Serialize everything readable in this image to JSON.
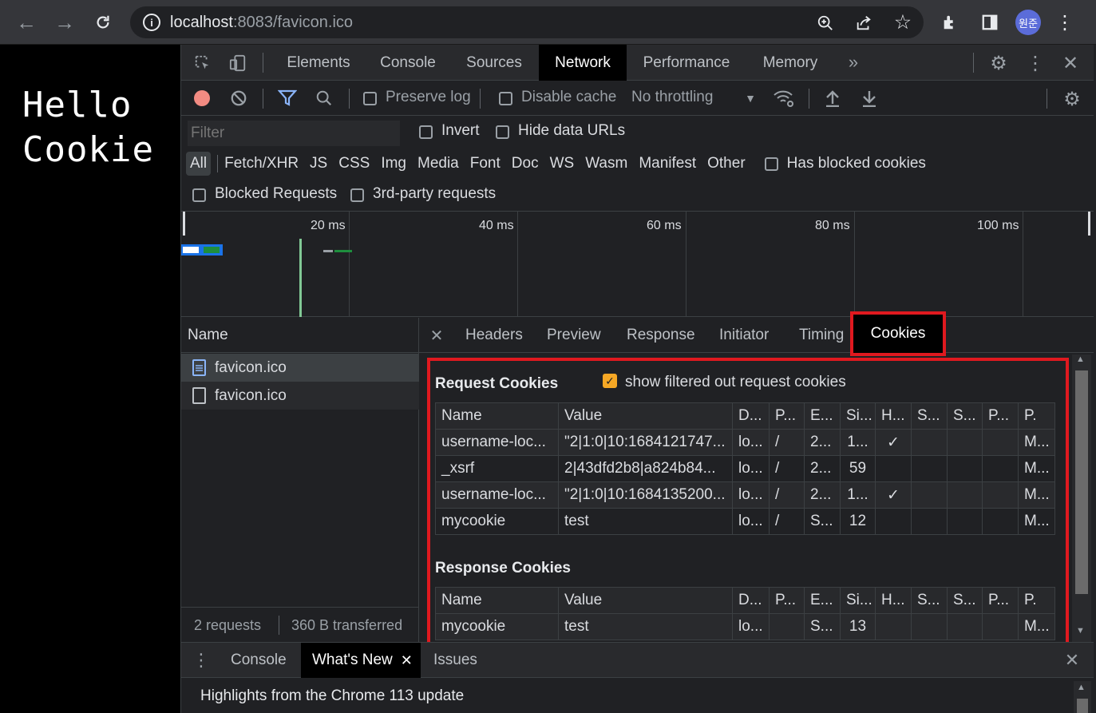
{
  "browser": {
    "url_host": "localhost",
    "url_rest": ":8083/favicon.ico",
    "avatar": "원준"
  },
  "page": {
    "line1": "Hello",
    "line2": "Cookie"
  },
  "devtools": {
    "main_tabs": [
      "Elements",
      "Console",
      "Sources",
      "Network",
      "Performance",
      "Memory"
    ],
    "active_tab": "Network",
    "toolbar": {
      "preserve_log": "Preserve log",
      "disable_cache": "Disable cache",
      "throttling": "No throttling"
    },
    "filter": {
      "placeholder": "Filter",
      "invert": "Invert",
      "hide_data_urls": "Hide data URLs"
    },
    "type_filters": [
      "All",
      "Fetch/XHR",
      "JS",
      "CSS",
      "Img",
      "Media",
      "Font",
      "Doc",
      "WS",
      "Wasm",
      "Manifest",
      "Other"
    ],
    "has_blocked_cookies": "Has blocked cookies",
    "blocked_requests": "Blocked Requests",
    "third_party": "3rd-party requests",
    "timeline_ticks": [
      "20 ms",
      "40 ms",
      "60 ms",
      "80 ms",
      "100 ms"
    ],
    "requests": {
      "header": "Name",
      "items": [
        "favicon.ico",
        "favicon.ico"
      ],
      "footer_count": "2 requests",
      "footer_transferred": "360 B transferred"
    },
    "detail_tabs": [
      "Headers",
      "Preview",
      "Response",
      "Initiator",
      "Timing",
      "Cookies"
    ],
    "active_detail_tab": "Cookies",
    "cookies": {
      "request_title": "Request Cookies",
      "show_filtered": "show filtered out request cookies",
      "columns": [
        "Name",
        "Value",
        "D...",
        "P...",
        "E...",
        "Si...",
        "H...",
        "S...",
        "S...",
        "P...",
        "P."
      ],
      "request_rows": [
        [
          "username-loc...",
          "\"2|1:0|10:1684121747...",
          "lo...",
          "/",
          "2...",
          "1...",
          "✓",
          "",
          "",
          "",
          "M..."
        ],
        [
          "_xsrf",
          "2|43dfd2b8|a824b84...",
          "lo...",
          "/",
          "2...",
          "59",
          "",
          "",
          "",
          "",
          "M..."
        ],
        [
          "username-loc...",
          "\"2|1:0|10:1684135200...",
          "lo...",
          "/",
          "2...",
          "1...",
          "✓",
          "",
          "",
          "",
          "M..."
        ],
        [
          "mycookie",
          "test",
          "lo...",
          "/",
          "S...",
          "12",
          "",
          "",
          "",
          "",
          "M..."
        ]
      ],
      "response_title": "Response Cookies",
      "response_rows": [
        [
          "mycookie",
          "test",
          "lo...",
          "",
          "S...",
          "13",
          "",
          "",
          "",
          "",
          "M..."
        ]
      ]
    },
    "drawer": {
      "tabs": [
        "Console",
        "What's New",
        "Issues"
      ],
      "active": "What's New",
      "headline": "Highlights from the Chrome 113 update"
    }
  },
  "colors": {
    "accent_blue": "#8ab4f8",
    "record_red": "#f28b82",
    "highlight_red": "#e0191f",
    "checkbox_orange": "#f6a825"
  }
}
